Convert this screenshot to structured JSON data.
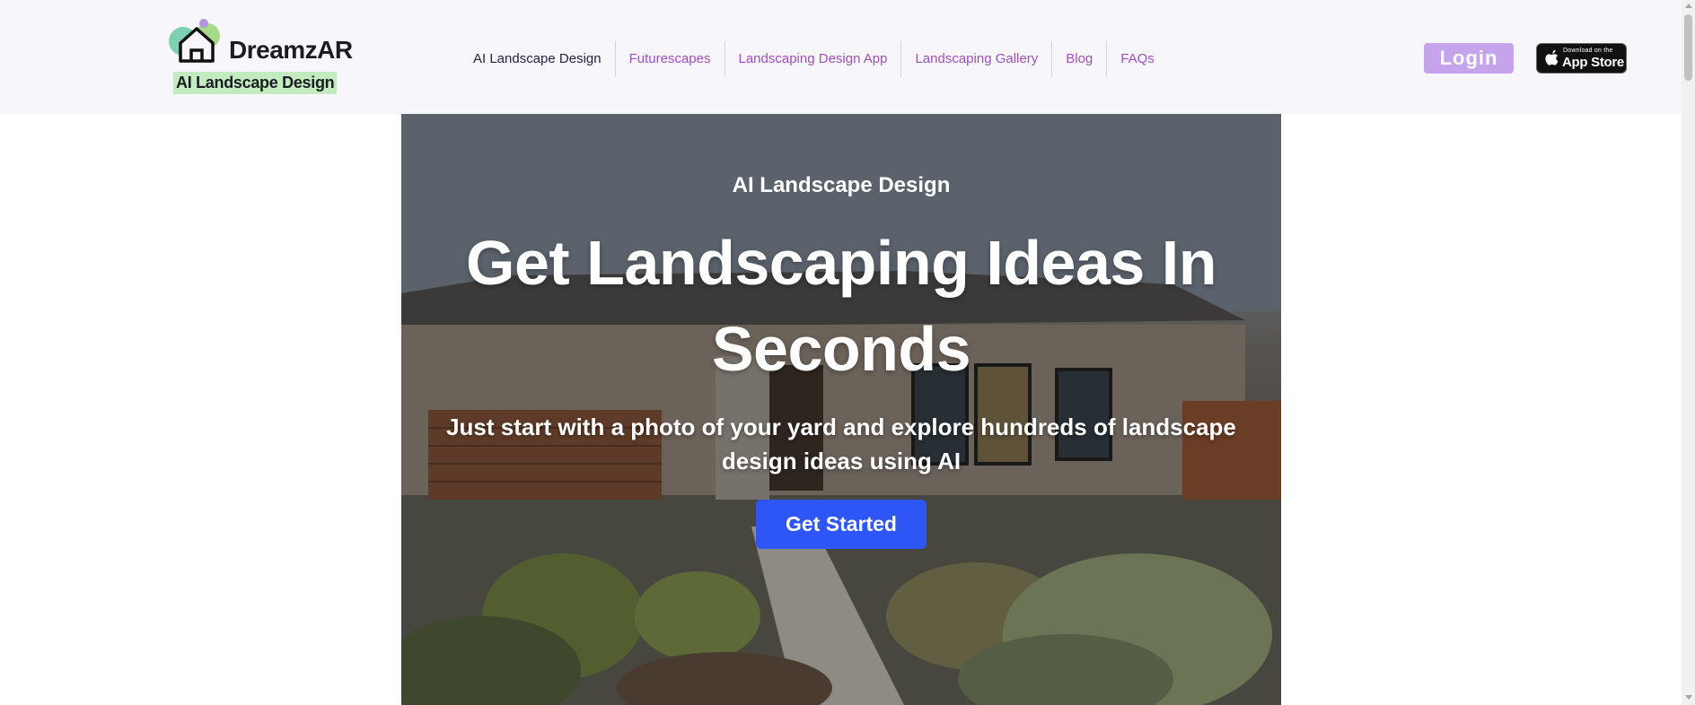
{
  "brand": {
    "name": "DreamzAR",
    "tagline": "AI Landscape Design"
  },
  "nav": {
    "items": [
      {
        "label": "AI Landscape Design"
      },
      {
        "label": "Futurescapes"
      },
      {
        "label": "Landscaping Design App"
      },
      {
        "label": "Landscaping Gallery"
      },
      {
        "label": "Blog"
      },
      {
        "label": "FAQs"
      }
    ]
  },
  "header": {
    "login_label": "Login",
    "appstore_small": "Download on the",
    "appstore_big": "App Store"
  },
  "hero": {
    "eyebrow": "AI Landscape Design",
    "title": "Get Landscaping Ideas In Seconds",
    "subtitle": "Just start with a photo of your yard and explore hundreds of landscape design ideas using AI",
    "cta_label": "Get Started"
  },
  "colors": {
    "header_bg": "#f7f6fb",
    "nav_link": "#a24fc0",
    "login_bg": "#c6a4ec",
    "cta_bg": "#2e55f5",
    "tag_bg": "#c3ebc0"
  }
}
